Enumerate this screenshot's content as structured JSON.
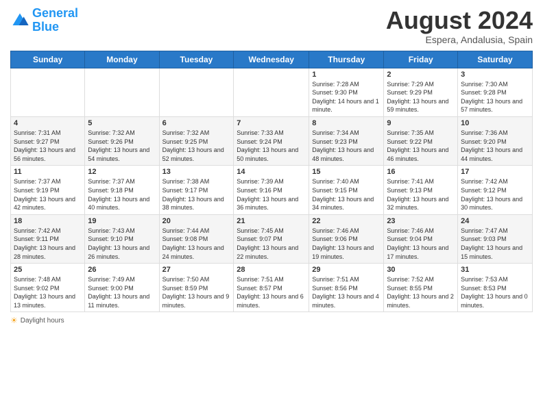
{
  "logo": {
    "line1": "General",
    "line2": "Blue"
  },
  "title": "August 2024",
  "subtitle": "Espera, Andalusia, Spain",
  "days_header": [
    "Sunday",
    "Monday",
    "Tuesday",
    "Wednesday",
    "Thursday",
    "Friday",
    "Saturday"
  ],
  "weeks": [
    [
      {
        "num": "",
        "info": ""
      },
      {
        "num": "",
        "info": ""
      },
      {
        "num": "",
        "info": ""
      },
      {
        "num": "",
        "info": ""
      },
      {
        "num": "1",
        "info": "Sunrise: 7:28 AM\nSunset: 9:30 PM\nDaylight: 14 hours and 1 minute."
      },
      {
        "num": "2",
        "info": "Sunrise: 7:29 AM\nSunset: 9:29 PM\nDaylight: 13 hours and 59 minutes."
      },
      {
        "num": "3",
        "info": "Sunrise: 7:30 AM\nSunset: 9:28 PM\nDaylight: 13 hours and 57 minutes."
      }
    ],
    [
      {
        "num": "4",
        "info": "Sunrise: 7:31 AM\nSunset: 9:27 PM\nDaylight: 13 hours and 56 minutes."
      },
      {
        "num": "5",
        "info": "Sunrise: 7:32 AM\nSunset: 9:26 PM\nDaylight: 13 hours and 54 minutes."
      },
      {
        "num": "6",
        "info": "Sunrise: 7:32 AM\nSunset: 9:25 PM\nDaylight: 13 hours and 52 minutes."
      },
      {
        "num": "7",
        "info": "Sunrise: 7:33 AM\nSunset: 9:24 PM\nDaylight: 13 hours and 50 minutes."
      },
      {
        "num": "8",
        "info": "Sunrise: 7:34 AM\nSunset: 9:23 PM\nDaylight: 13 hours and 48 minutes."
      },
      {
        "num": "9",
        "info": "Sunrise: 7:35 AM\nSunset: 9:22 PM\nDaylight: 13 hours and 46 minutes."
      },
      {
        "num": "10",
        "info": "Sunrise: 7:36 AM\nSunset: 9:20 PM\nDaylight: 13 hours and 44 minutes."
      }
    ],
    [
      {
        "num": "11",
        "info": "Sunrise: 7:37 AM\nSunset: 9:19 PM\nDaylight: 13 hours and 42 minutes."
      },
      {
        "num": "12",
        "info": "Sunrise: 7:37 AM\nSunset: 9:18 PM\nDaylight: 13 hours and 40 minutes."
      },
      {
        "num": "13",
        "info": "Sunrise: 7:38 AM\nSunset: 9:17 PM\nDaylight: 13 hours and 38 minutes."
      },
      {
        "num": "14",
        "info": "Sunrise: 7:39 AM\nSunset: 9:16 PM\nDaylight: 13 hours and 36 minutes."
      },
      {
        "num": "15",
        "info": "Sunrise: 7:40 AM\nSunset: 9:15 PM\nDaylight: 13 hours and 34 minutes."
      },
      {
        "num": "16",
        "info": "Sunrise: 7:41 AM\nSunset: 9:13 PM\nDaylight: 13 hours and 32 minutes."
      },
      {
        "num": "17",
        "info": "Sunrise: 7:42 AM\nSunset: 9:12 PM\nDaylight: 13 hours and 30 minutes."
      }
    ],
    [
      {
        "num": "18",
        "info": "Sunrise: 7:42 AM\nSunset: 9:11 PM\nDaylight: 13 hours and 28 minutes."
      },
      {
        "num": "19",
        "info": "Sunrise: 7:43 AM\nSunset: 9:10 PM\nDaylight: 13 hours and 26 minutes."
      },
      {
        "num": "20",
        "info": "Sunrise: 7:44 AM\nSunset: 9:08 PM\nDaylight: 13 hours and 24 minutes."
      },
      {
        "num": "21",
        "info": "Sunrise: 7:45 AM\nSunset: 9:07 PM\nDaylight: 13 hours and 22 minutes."
      },
      {
        "num": "22",
        "info": "Sunrise: 7:46 AM\nSunset: 9:06 PM\nDaylight: 13 hours and 19 minutes."
      },
      {
        "num": "23",
        "info": "Sunrise: 7:46 AM\nSunset: 9:04 PM\nDaylight: 13 hours and 17 minutes."
      },
      {
        "num": "24",
        "info": "Sunrise: 7:47 AM\nSunset: 9:03 PM\nDaylight: 13 hours and 15 minutes."
      }
    ],
    [
      {
        "num": "25",
        "info": "Sunrise: 7:48 AM\nSunset: 9:02 PM\nDaylight: 13 hours and 13 minutes."
      },
      {
        "num": "26",
        "info": "Sunrise: 7:49 AM\nSunset: 9:00 PM\nDaylight: 13 hours and 11 minutes."
      },
      {
        "num": "27",
        "info": "Sunrise: 7:50 AM\nSunset: 8:59 PM\nDaylight: 13 hours and 9 minutes."
      },
      {
        "num": "28",
        "info": "Sunrise: 7:51 AM\nSunset: 8:57 PM\nDaylight: 13 hours and 6 minutes."
      },
      {
        "num": "29",
        "info": "Sunrise: 7:51 AM\nSunset: 8:56 PM\nDaylight: 13 hours and 4 minutes."
      },
      {
        "num": "30",
        "info": "Sunrise: 7:52 AM\nSunset: 8:55 PM\nDaylight: 13 hours and 2 minutes."
      },
      {
        "num": "31",
        "info": "Sunrise: 7:53 AM\nSunset: 8:53 PM\nDaylight: 13 hours and 0 minutes."
      }
    ]
  ],
  "footer": {
    "daylight_label": "Daylight hours"
  }
}
